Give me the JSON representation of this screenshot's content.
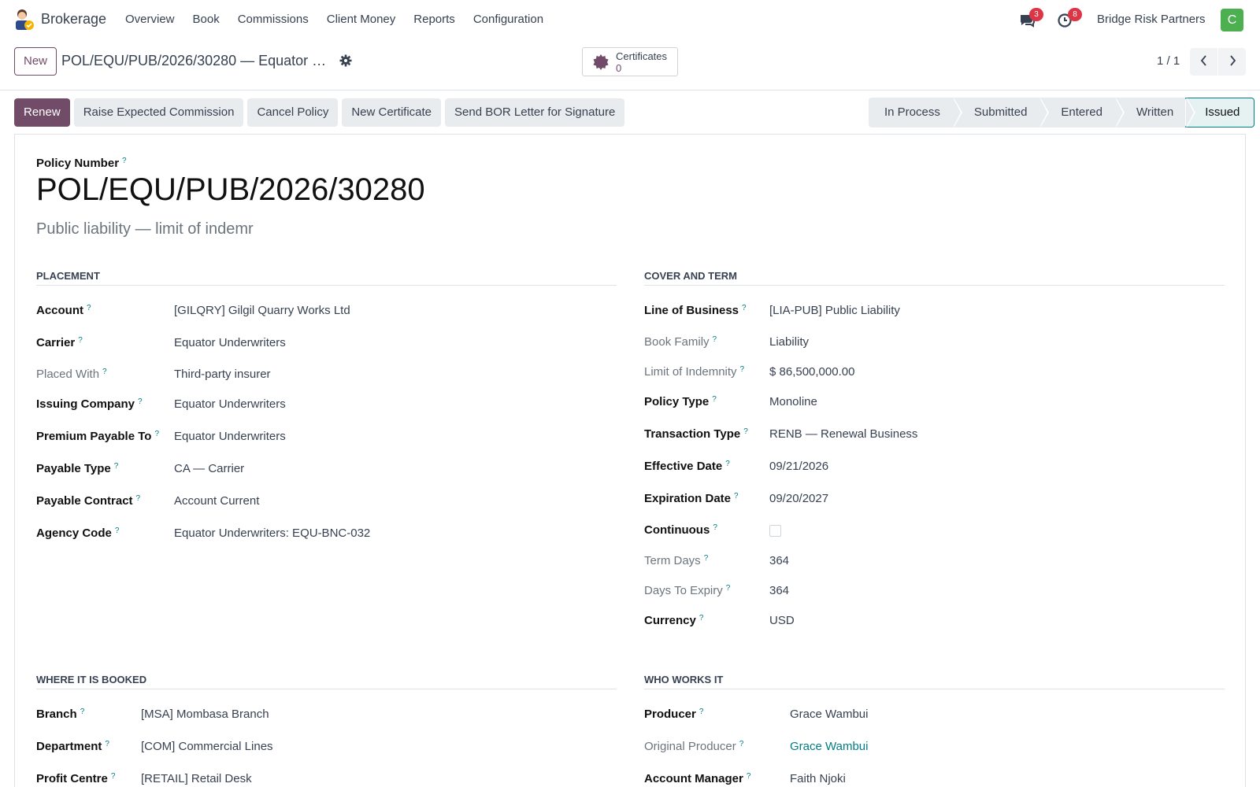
{
  "navbar": {
    "app_name": "Brokerage",
    "menu": [
      "Overview",
      "Book",
      "Commissions",
      "Client Money",
      "Reports",
      "Configuration"
    ],
    "messages_count": "3",
    "activities_count": "8",
    "company": "Bridge Risk Partners",
    "avatar_initial": "C"
  },
  "control_panel": {
    "new_label": "New",
    "breadcrumb": "POL/EQU/PUB/2026/30280 — Equator …",
    "smart_button": {
      "label": "Certificates",
      "value": "0"
    },
    "pager": "1 / 1"
  },
  "actions": [
    "Renew",
    "Raise Expected Commission",
    "Cancel Policy",
    "New Certificate",
    "Send BOR Letter for Signature"
  ],
  "stages": [
    "In Process",
    "Submitted",
    "Entered",
    "Written",
    "Issued"
  ],
  "active_stage": "Issued",
  "form": {
    "policy_number_label": "Policy Number",
    "policy_number": "POL/EQU/PUB/2026/30280",
    "description": "Public liability — limit of indemr",
    "placement": {
      "title": "PLACEMENT",
      "fields": [
        {
          "label": "Account",
          "value": "[GILQRY] Gilgil Quarry Works Ltd"
        },
        {
          "label": "Carrier",
          "value": "Equator Underwriters"
        },
        {
          "label": "Placed With",
          "value": "Third-party insurer"
        },
        {
          "label": "Issuing Company",
          "value": "Equator Underwriters"
        },
        {
          "label": "Premium Payable To",
          "value": "Equator Underwriters"
        },
        {
          "label": "Payable Type",
          "value": "CA — Carrier"
        },
        {
          "label": "Payable Contract",
          "value": "Account Current"
        },
        {
          "label": "Agency Code",
          "value": "Equator Underwriters: EQU-BNC-032"
        }
      ]
    },
    "cover": {
      "title": "COVER AND TERM",
      "fields": [
        {
          "label": "Line of Business",
          "value": "[LIA-PUB] Public Liability"
        },
        {
          "label": "Book Family",
          "value": "Liability"
        },
        {
          "label": "Limit of Indemnity",
          "value": "$ 86,500,000.00"
        },
        {
          "label": "Policy Type",
          "value": "Monoline"
        },
        {
          "label": "Transaction Type",
          "value": "RENB — Renewal Business"
        },
        {
          "label": "Effective Date",
          "value": "09/21/2026"
        },
        {
          "label": "Expiration Date",
          "value": "09/20/2027"
        },
        {
          "label": "Continuous",
          "value": ""
        },
        {
          "label": "Term Days",
          "value": "364"
        },
        {
          "label": "Days To Expiry",
          "value": "364"
        },
        {
          "label": "Currency",
          "value": "USD"
        }
      ]
    },
    "booked": {
      "title": "WHERE IT IS BOOKED",
      "fields": [
        {
          "label": "Branch",
          "value": "[MSA] Mombasa Branch"
        },
        {
          "label": "Department",
          "value": "[COM] Commercial Lines"
        },
        {
          "label": "Profit Centre",
          "value": "[RETAIL] Retail Desk"
        }
      ]
    },
    "who": {
      "title": "WHO WORKS IT",
      "fields": [
        {
          "label": "Producer",
          "value": "Grace Wambui"
        },
        {
          "label": "Original Producer",
          "value": "Grace Wambui"
        },
        {
          "label": "Account Manager",
          "value": "Faith Njoki"
        }
      ]
    }
  },
  "colors": {
    "brand": "#714b67",
    "accent": "#017e84",
    "badge": "#dc3545",
    "avatar": "#4caf50"
  },
  "icons": [
    "app-logo-icon",
    "chat-icon",
    "clock-icon",
    "gear-icon",
    "certificate-icon",
    "chevron-left-icon",
    "chevron-right-icon"
  ]
}
